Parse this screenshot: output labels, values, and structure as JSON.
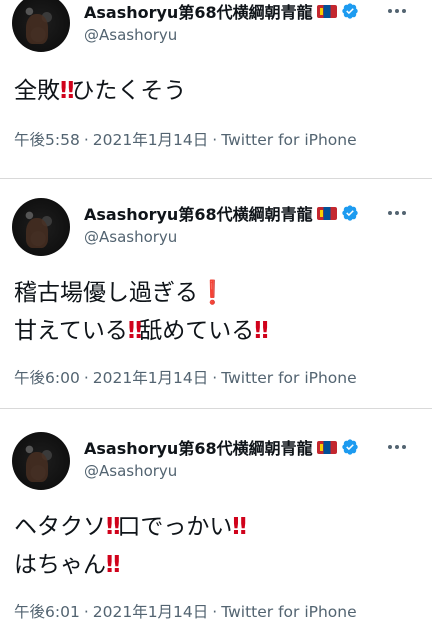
{
  "account": {
    "display_name": "Asashoryu第68代横綱朝青龍",
    "handle": "@Asashoryu",
    "flag": "mongolia-flag-icon",
    "verified": true
  },
  "tweets": [
    {
      "lines": [
        {
          "segments": [
            "全敗",
            "‼",
            "ひたくそう"
          ]
        }
      ],
      "time": "午後5:58",
      "date": "2021年1月14日",
      "source": "Twitter for iPhone"
    },
    {
      "lines": [
        {
          "segments": [
            "稽古場優し過ぎる",
            "❗"
          ]
        },
        {
          "segments": [
            "甘えている",
            "‼",
            "舐めている",
            "‼"
          ]
        }
      ],
      "time": "午後6:00",
      "date": "2021年1月14日",
      "source": "Twitter for iPhone"
    },
    {
      "lines": [
        {
          "segments": [
            "ヘタクソ",
            "‼",
            "口でっかい",
            "‼"
          ]
        },
        {
          "segments": [
            "はちゃん",
            "‼"
          ]
        }
      ],
      "time": "午後6:01",
      "date": "2021年1月14日",
      "source": "Twitter for iPhone"
    }
  ],
  "colors": {
    "text": "#0f1419",
    "secondary": "#536471",
    "verified": "#1d9bf0",
    "exclamation": "#d0021b"
  },
  "meta_separator": "·"
}
